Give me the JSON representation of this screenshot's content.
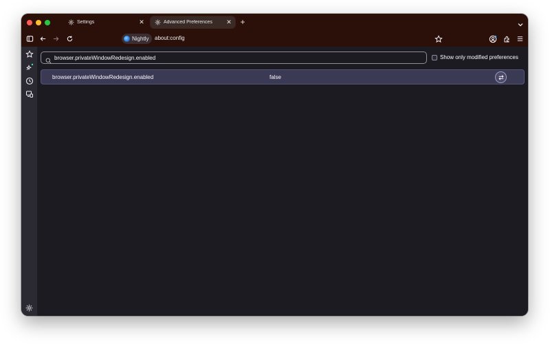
{
  "tabs": [
    {
      "title": "Settings",
      "icon": "gear-icon",
      "active": false
    },
    {
      "title": "Advanced Preferences",
      "icon": "gear-icon",
      "active": true
    }
  ],
  "navbar": {
    "identity_label": "Nightly",
    "url": "about:config"
  },
  "search": {
    "value": "browser.privateWindowRedesign.enabled"
  },
  "modified_only_label": "Show only modified preferences",
  "preferences": [
    {
      "name": "browser.privateWindowRedesign.enabled",
      "value": "false"
    }
  ],
  "colors": {
    "toolbar": "#2b0f09",
    "content": "#1c1b22",
    "sidebar": "#2b2a33",
    "row_highlight": "#3a3a55"
  }
}
